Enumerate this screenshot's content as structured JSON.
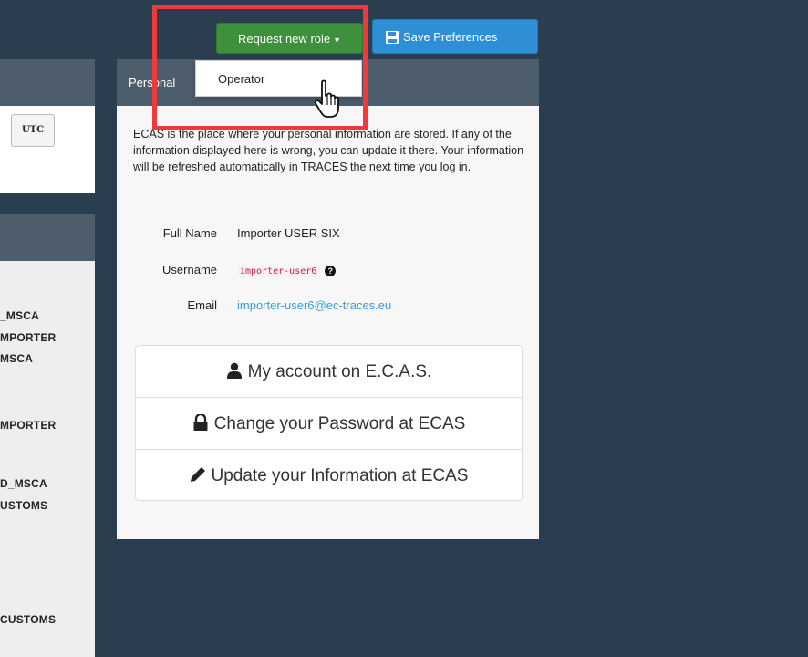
{
  "toolbar": {
    "request_role_label": "Request new role",
    "save_preferences_label": "Save Preferences"
  },
  "dropdown": {
    "items": [
      "Operator"
    ]
  },
  "left": {
    "timezone_button": "UTC",
    "roles": [
      "_MSCA",
      "MPORTER",
      "MSCA",
      "MPORTER",
      "D_MSCA",
      "USTOMS",
      "CUSTOMS"
    ]
  },
  "personal": {
    "title": "Personal",
    "intro": "ECAS is the place where your personal information are stored. If any of the information displayed here is wrong, you can update it there. Your information will be refreshed automatically in TRACES the next time you log in.",
    "full_name_label": "Full Name",
    "full_name_value": "Importer USER SIX",
    "username_label": "Username",
    "username_value": "importer-user6",
    "email_label": "Email",
    "email_value": "importer-user6@ec-traces.eu",
    "actions": [
      {
        "label": "My account on E.C.A.S.",
        "icon": "user-icon"
      },
      {
        "label": "Change your Password at ECAS",
        "icon": "lock-icon"
      },
      {
        "label": "Update your Information at ECAS",
        "icon": "pencil-icon"
      }
    ]
  },
  "colors": {
    "background": "#2b3e50",
    "panel_header": "#4e5d6c",
    "success": "#3e8f3e",
    "primary": "#2f8fd6",
    "highlight": "#ef3a3a"
  }
}
